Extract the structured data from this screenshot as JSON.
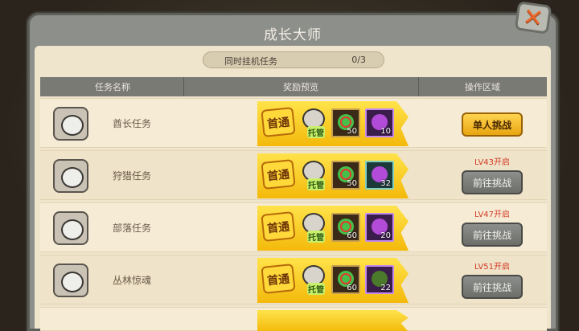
{
  "window": {
    "title": "成长大师",
    "close_icon": "x-icon"
  },
  "progress": {
    "label": "同时挂机任务",
    "count": "0/3"
  },
  "columns": [
    "任务名称",
    "奖励预览",
    "操作区域"
  ],
  "rows": [
    {
      "name": "酋长任务",
      "first": "首通",
      "tag": "托管",
      "items": [
        {
          "num": "50"
        },
        {
          "num": "10"
        }
      ],
      "level": "",
      "button": "单人挑战",
      "style": "gold"
    },
    {
      "name": "狩猎任务",
      "first": "首通",
      "tag": "托管",
      "items": [
        {
          "num": "50"
        },
        {
          "num": "32"
        }
      ],
      "level": "LV43开启",
      "button": "前往挑战",
      "style": "gray"
    },
    {
      "name": "部落任务",
      "first": "首通",
      "tag": "托管",
      "items": [
        {
          "num": "60"
        },
        {
          "num": "20"
        }
      ],
      "level": "LV47开启",
      "button": "前往挑战",
      "style": "gray"
    },
    {
      "name": "丛林惊魂",
      "first": "首通",
      "tag": "托管",
      "items": [
        {
          "num": "60"
        },
        {
          "num": "22"
        }
      ],
      "level": "LV51开启",
      "button": "前往挑战",
      "style": "gray"
    }
  ]
}
